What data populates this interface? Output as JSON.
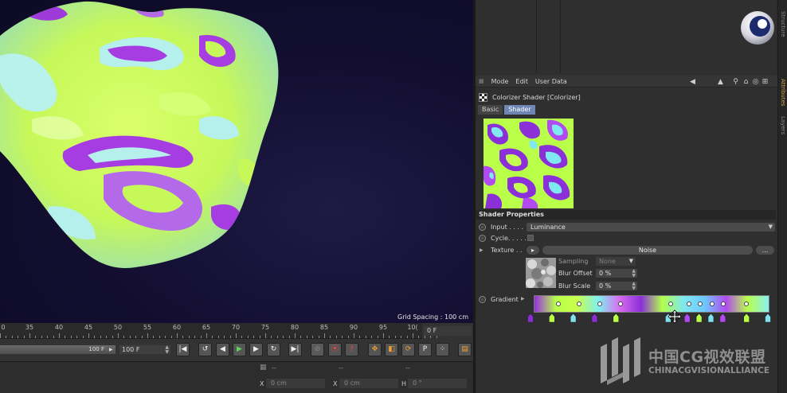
{
  "viewport": {
    "grid_spacing": "Grid Spacing : 100 cm"
  },
  "side_tabs": [
    "Structure",
    "Attributes",
    "Layers"
  ],
  "attributes": {
    "menu": [
      "Mode",
      "Edit",
      "User Data"
    ],
    "object_title": "Colorizer Shader [Colorizer]",
    "tabs": [
      "Basic",
      "Shader"
    ],
    "active_tab": "Shader",
    "section_title": "Shader Properties",
    "input": {
      "label": "Input . . . .",
      "value": "Luminance"
    },
    "cycle": {
      "label": "Cycle. . . . ."
    },
    "texture": {
      "label": "Texture . .",
      "button": "Noise",
      "more": "..."
    },
    "sampling": {
      "label": "Sampling",
      "value": "None"
    },
    "blur_offset": {
      "label": "Blur Offset",
      "value": "0 %"
    },
    "blur_scale": {
      "label": "Blur Scale",
      "value": "0 %"
    },
    "gradient": {
      "label": "Gradient",
      "colors": [
        "#9a2fe0",
        "#b7ff4a",
        "#c8ff4e",
        "#7ff0f0",
        "#d86bf0",
        "#8a2fd8",
        "#b2ff4a",
        "#7ee8ee",
        "#6ec8ff",
        "#b24af0",
        "#b9ff4a",
        "#88f0f0"
      ],
      "knots": [
        {
          "pos": 0.0,
          "color": "#8a2fd8"
        },
        {
          "pos": 0.09,
          "color": "#b9ff4a"
        },
        {
          "pos": 0.18,
          "color": "#7fe0f0"
        },
        {
          "pos": 0.27,
          "color": "#8a2fd8"
        },
        {
          "pos": 0.36,
          "color": "#b9ff4a"
        },
        {
          "pos": 0.58,
          "color": "#7fe0f0"
        },
        {
          "pos": 0.66,
          "color": "#b24af0"
        },
        {
          "pos": 0.71,
          "color": "#b9ff4a"
        },
        {
          "pos": 0.76,
          "color": "#7fe0f0"
        },
        {
          "pos": 0.81,
          "color": "#b24af0"
        },
        {
          "pos": 0.91,
          "color": "#b9ff4a"
        },
        {
          "pos": 1.0,
          "color": "#7fe0f0"
        }
      ]
    }
  },
  "timeline": {
    "ticks": [
      "0",
      "35",
      "40",
      "45",
      "50",
      "55",
      "60",
      "65",
      "70",
      "75",
      "80",
      "85",
      "90",
      "95",
      "10("
    ],
    "current_frame": "0 F",
    "scrub_value": "100 F",
    "end_value": "100 F"
  },
  "coords": {
    "headers": [
      "--",
      "--",
      "--"
    ],
    "rows": [
      {
        "axis": "X",
        "val": "0 cm"
      },
      {
        "axis": "X",
        "val": "0 cm"
      },
      {
        "axis": "H",
        "val": "0 °"
      }
    ]
  },
  "watermark": {
    "cn": "中国CG视效联盟",
    "en": "CHINACGVISIONALLIANCE"
  }
}
